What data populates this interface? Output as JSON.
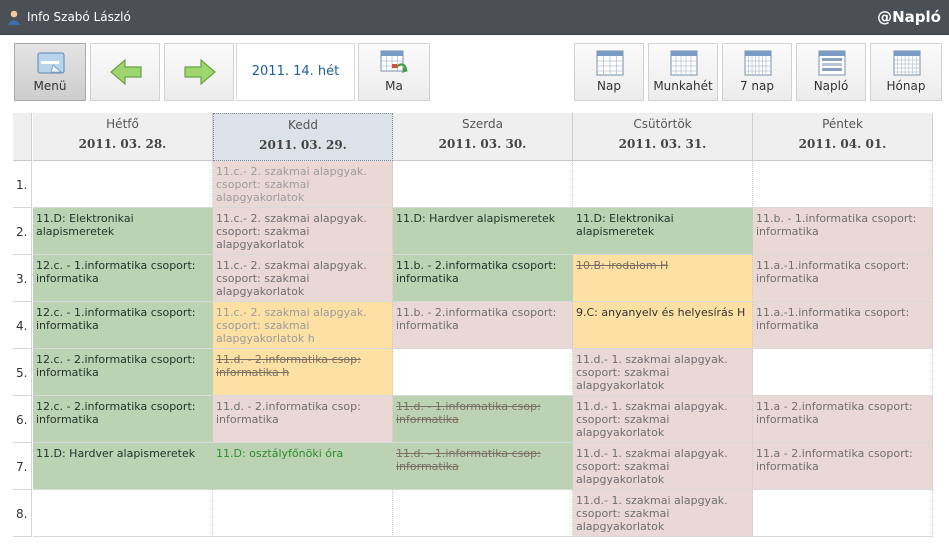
{
  "header": {
    "user_name": "Info Szabó László",
    "app_name": "@Napló"
  },
  "toolbar": {
    "menu_label": "Menü",
    "week_label": "2011. 14. hét",
    "today_label": "Ma",
    "views": [
      {
        "label": "Nap"
      },
      {
        "label": "Munkahét"
      },
      {
        "label": "7 nap"
      },
      {
        "label": "Napló"
      },
      {
        "label": "Hónap"
      }
    ]
  },
  "days": [
    {
      "name": "Hétfő",
      "date": "2011. 03. 28."
    },
    {
      "name": "Kedd",
      "date": "2011. 03. 29."
    },
    {
      "name": "Szerda",
      "date": "2011. 03. 30."
    },
    {
      "name": "Csütörtök",
      "date": "2011. 03. 31."
    },
    {
      "name": "Péntek",
      "date": "2011. 04. 01."
    }
  ],
  "rows": [
    {
      "num": "1.",
      "cells": [
        {
          "text": "",
          "style": "empty"
        },
        {
          "text": "11.c.- 2. szakmai alapgyak. csoport: szakmai alapgyakorlatok",
          "style": "pink-faded"
        },
        {
          "text": "",
          "style": "empty"
        },
        {
          "text": "",
          "style": "empty"
        },
        {
          "text": "",
          "style": "empty"
        }
      ]
    },
    {
      "num": "2.",
      "cells": [
        {
          "text": "11.D: Elektronikai alapismeretek",
          "style": "green"
        },
        {
          "text": "11.c.- 2. szakmai alapgyak. csoport: szakmai alapgyakorlatok",
          "style": "pink"
        },
        {
          "text": "11.D: Hardver alapismeretek",
          "style": "green"
        },
        {
          "text": "11.D: Elektronikai alapismeretek",
          "style": "green"
        },
        {
          "text": "11.b. - 1.informatika csoport: informatika",
          "style": "pink"
        }
      ]
    },
    {
      "num": "3.",
      "cells": [
        {
          "text": "12.c. - 1.informatika csoport: informatika",
          "style": "green"
        },
        {
          "text": "11.c.- 2. szakmai alapgyak. csoport: szakmai alapgyakorlatok",
          "style": "pink"
        },
        {
          "text": "11.b. - 2.informatika csoport: informatika",
          "style": "green"
        },
        {
          "text": "10.B: irodalom H",
          "style": "orange-cancel"
        },
        {
          "text": "11.a.-1.informatika csoport: informatika",
          "style": "pink"
        }
      ]
    },
    {
      "num": "4.",
      "cells": [
        {
          "text": "12.c. - 1.informatika csoport: informatika",
          "style": "green"
        },
        {
          "text": "11.c.- 2. szakmai alapgyak. csoport: szakmai alapgyakorlatok h",
          "style": "orange-faded"
        },
        {
          "text": "11.b. - 2.informatika csoport: informatika",
          "style": "pink"
        },
        {
          "text": "9.C: anyanyelv és helyesírás H",
          "style": "orange"
        },
        {
          "text": "11.a.-1.informatika csoport: informatika",
          "style": "pink"
        }
      ]
    },
    {
      "num": "5.",
      "cells": [
        {
          "text": "12.c. - 2.informatika csoport: informatika",
          "style": "green"
        },
        {
          "text": "11.d. - 2.informatika csop: informatika h",
          "style": "orange-cancel"
        },
        {
          "text": "",
          "style": "empty"
        },
        {
          "text": "11.d.- 1. szakmai alapgyak. csoport: szakmai alapgyakorlatok",
          "style": "pink"
        },
        {
          "text": "",
          "style": "empty"
        }
      ]
    },
    {
      "num": "6.",
      "cells": [
        {
          "text": "12.c. - 2.informatika csoport: informatika",
          "style": "green"
        },
        {
          "text": "11.d. - 2.informatika csop: informatika",
          "style": "pink"
        },
        {
          "text": "11.d. - 1.informatika csop: informatika",
          "style": "green-cancel"
        },
        {
          "text": "11.d.- 1. szakmai alapgyak. csoport: szakmai alapgyakorlatok",
          "style": "pink"
        },
        {
          "text": "11.a - 2.informatika csoport: informatika",
          "style": "pink"
        }
      ]
    },
    {
      "num": "7.",
      "cells": [
        {
          "text": "11.D: Hardver alapismeretek",
          "style": "green"
        },
        {
          "text": "11.D: osztályfőnöki óra",
          "style": "green-greentext"
        },
        {
          "text": "11.d. - 1.informatika csop: informatika",
          "style": "green-cancel"
        },
        {
          "text": "11.d.- 1. szakmai alapgyak. csoport: szakmai alapgyakorlatok",
          "style": "pink"
        },
        {
          "text": "11.a - 2.informatika csoport: informatika",
          "style": "pink"
        }
      ]
    },
    {
      "num": "8.",
      "cells": [
        {
          "text": "",
          "style": "empty"
        },
        {
          "text": "",
          "style": "empty"
        },
        {
          "text": "",
          "style": "empty"
        },
        {
          "text": "11.d.- 1. szakmai alapgyak. csoport: szakmai alapgyakorlatok",
          "style": "pink"
        },
        {
          "text": "",
          "style": "empty"
        }
      ]
    }
  ]
}
